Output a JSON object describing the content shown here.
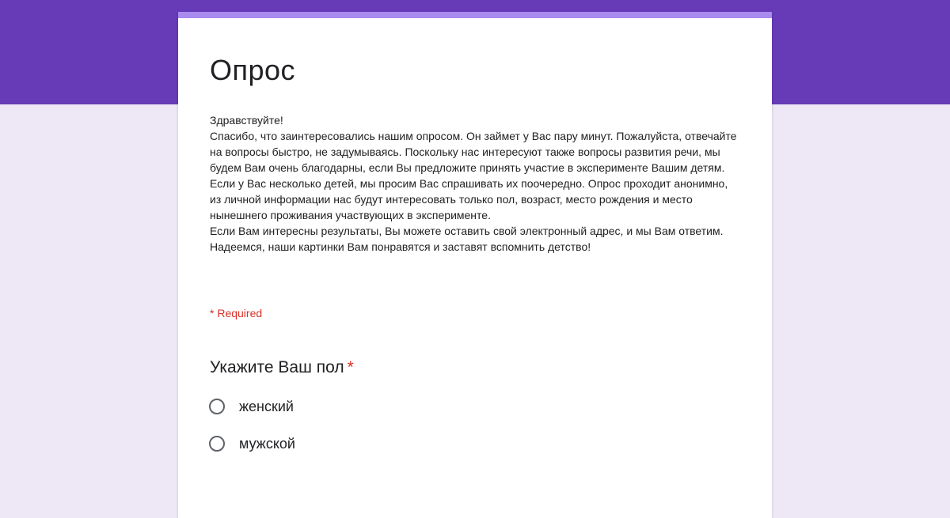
{
  "colors": {
    "header_band": "#673ab7",
    "page_background": "#ede7f6",
    "card_accent": "#a98bf0",
    "required": "#d93025"
  },
  "form": {
    "title": "Опрос",
    "description": "Здравствуйте!\nСпасибо, что заинтересовались нашим опросом. Он займет у Вас пару минут. Пожалуйста, отвечайте на вопросы быстро, не задумываясь. Поскольку нас интересуют также вопросы развития речи, мы будем Вам очень благодарны, если Вы предложите принять участие в эксперименте Вашим детям. Если у Вас несколько детей, мы просим Вас спрашивать их поочередно. Опрос проходит анонимно, из личной информации нас будут интересовать только пол, возраст, место рождения и место нынешнего проживания участвующих в эксперименте.\nЕсли Вам интересны результаты, Вы можете оставить свой электронный адрес, и мы Вам ответим.\nНадеемся, наши картинки Вам понравятся и заставят вспомнить детство!",
    "required_note": "* Required"
  },
  "question": {
    "title": "Укажите Ваш пол",
    "required_mark": "*",
    "options": [
      {
        "label": "женский",
        "selected": false
      },
      {
        "label": "мужской",
        "selected": false
      }
    ]
  }
}
